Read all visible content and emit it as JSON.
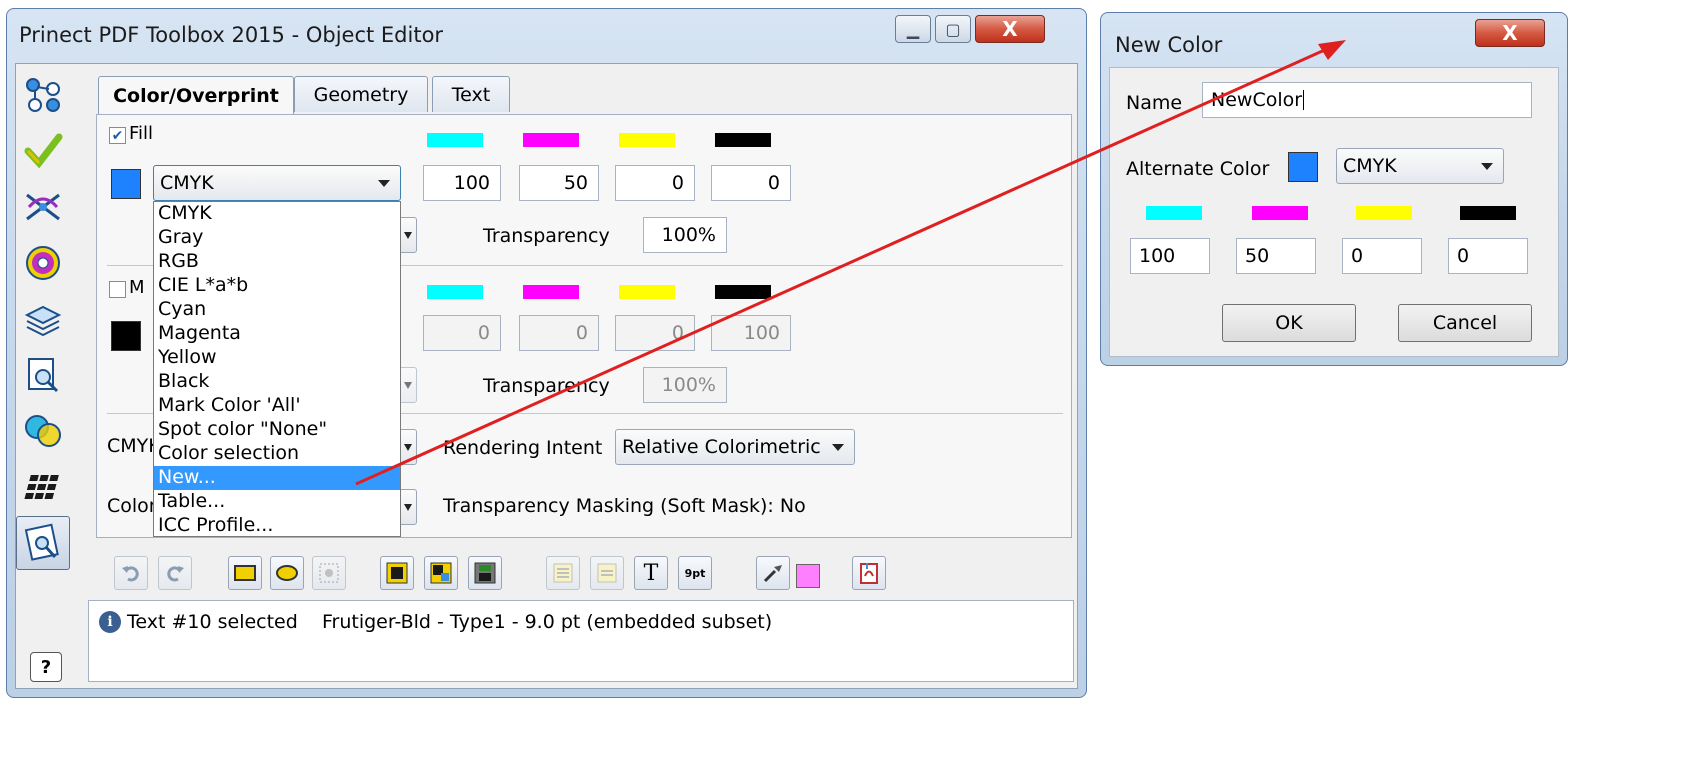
{
  "editor": {
    "title": "Prinect PDF Toolbox 2015 - Object Editor",
    "tabs": [
      "Color/Overprint",
      "Geometry",
      "Text"
    ],
    "fill": {
      "checkbox_label": "Fill",
      "checked": true,
      "swatch_color": "#1e82ff",
      "colorspace": "CMYK",
      "values": [
        "100",
        "50",
        "0",
        "0"
      ],
      "transparency_label": "Transparency",
      "transparency": "100%"
    },
    "stroke": {
      "checkbox_label": "M",
      "checked": false,
      "swatch_color": "#000000",
      "values": [
        "0",
        "0",
        "0",
        "100"
      ],
      "transparency_label": "Transparency",
      "transparency": "100%"
    },
    "ink_colors": [
      "#00ffff",
      "#ff00ff",
      "#ffff00",
      "#000000"
    ],
    "cmyk_label": "CMYK",
    "color_label": "Color",
    "rendering_intent_label": "Rendering Intent",
    "rendering_intent": "Relative Colorimetric",
    "soft_mask_text": "Transparency Masking (Soft Mask): No",
    "dropdown": {
      "items": [
        "CMYK",
        "Gray",
        "RGB",
        "CIE L*a*b",
        "Cyan",
        "Magenta",
        "Yellow",
        "Black",
        "Mark Color 'All'",
        "Spot color \"None\"",
        "Color selection",
        "New...",
        "Table...",
        "ICC Profile..."
      ],
      "selected_index": 11
    },
    "toolbar": {
      "font_size_label": "9pt",
      "text_icon_label": "T",
      "highlight_color": "#ff80ff"
    },
    "status": "Text #10 selected    Frutiger-Bld - Type1 - 9.0 pt (embedded subset)",
    "help_label": "?",
    "title_buttons": {
      "close": "X"
    }
  },
  "new_color": {
    "title": "New Color",
    "close_label": "X",
    "name_label": "Name",
    "name_value": "NewColor",
    "alternate_label": "Alternate Color",
    "alternate_swatch": "#1e82ff",
    "colorspace": "CMYK",
    "values": [
      "100",
      "50",
      "0",
      "0"
    ],
    "ok": "OK",
    "cancel": "Cancel"
  },
  "arrow_color": "#e02020"
}
